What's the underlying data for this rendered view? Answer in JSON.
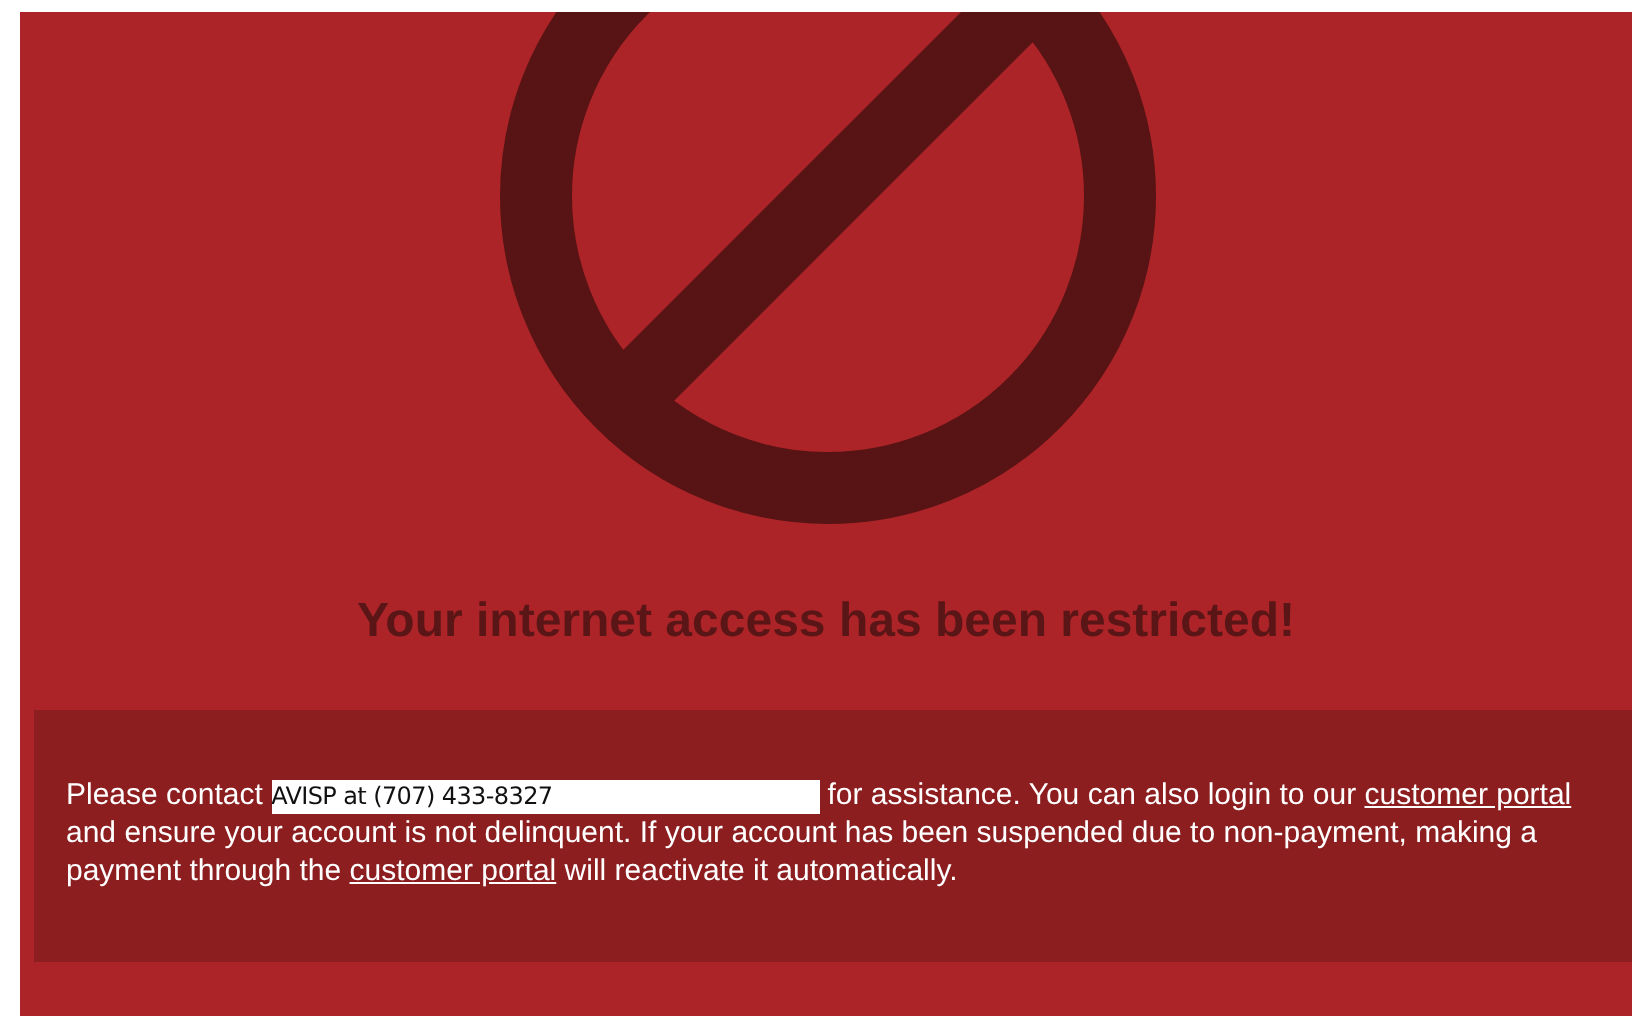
{
  "heading": "Your internet access has been restricted!",
  "notice": {
    "segments": [
      {
        "kind": "text",
        "text": "Please contact "
      },
      {
        "kind": "field",
        "text": "AVISP at (707) 433-8327"
      },
      {
        "kind": "text",
        "text": " for assistance. You can also login to our "
      },
      {
        "kind": "link",
        "text": "customer portal"
      },
      {
        "kind": "text",
        "text": " and ensure your account is not delinquent. If your account has been suspended due to non-payment, making a payment through the "
      },
      {
        "kind": "link",
        "text": "customer portal"
      },
      {
        "kind": "text",
        "text": " will reactivate it automatically."
      }
    ]
  }
}
